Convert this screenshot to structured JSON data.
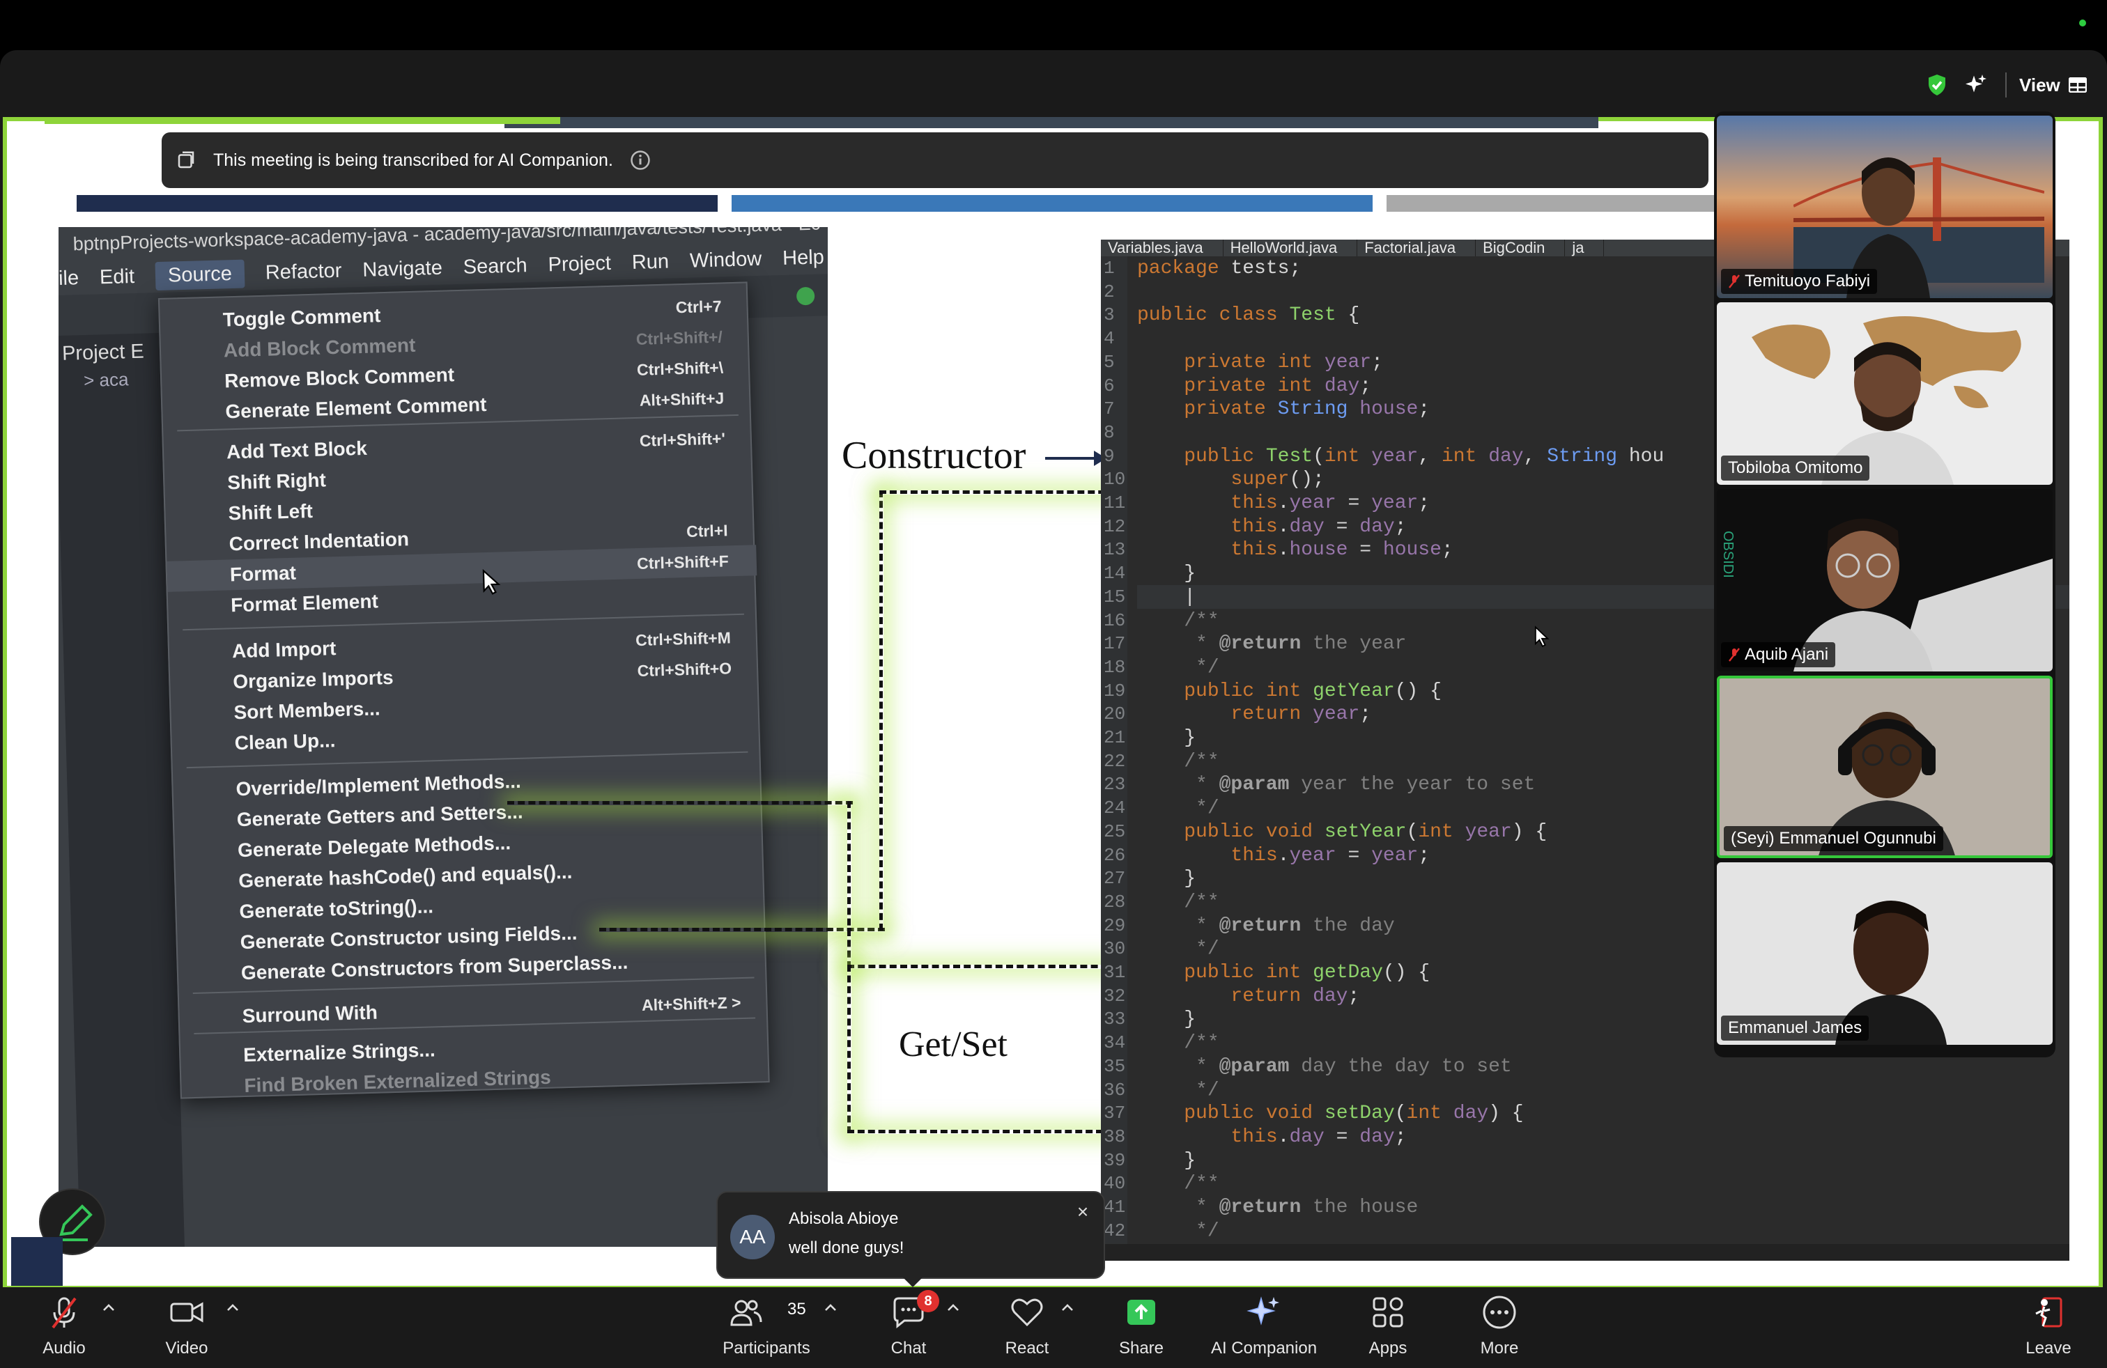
{
  "window": {
    "status_color": "#2ecc40"
  },
  "topbar": {
    "view_label": "View",
    "shield_icon": "shield-check-icon",
    "sparkle_icon": "ai-sparkle-icon"
  },
  "transcription_banner": {
    "text": "This meeting is being transcribed for AI Companion."
  },
  "slide": {
    "label_constructor": "Constructor",
    "label_getset": "Get/Set",
    "accent_colors": [
      "#1f2d4e",
      "#3a78b8",
      "#a9a9a9",
      "#8ed43a"
    ]
  },
  "eclipse": {
    "title": "bptnpProjects-workspace-academy-java - academy-java/src/main/java/tests/Test.java - Ec",
    "menubar": [
      "ile",
      "Edit",
      "Source",
      "Refactor",
      "Navigate",
      "Search",
      "Project",
      "Run",
      "Window",
      "Help"
    ],
    "active_menu": "Source",
    "project_panel_title": "Project E",
    "project_row": "> aca",
    "menu_items": [
      {
        "label": "Toggle Comment",
        "shortcut": "Ctrl+7"
      },
      {
        "label": "Add Block Comment",
        "shortcut": "Ctrl+Shift+/",
        "disabled": true
      },
      {
        "label": "Remove Block Comment",
        "shortcut": "Ctrl+Shift+\\"
      },
      {
        "label": "Generate Element Comment",
        "shortcut": "Alt+Shift+J"
      },
      {
        "label": "Add Text Block",
        "shortcut": "Ctrl+Shift+'"
      },
      {
        "label": "Shift Right",
        "shortcut": ""
      },
      {
        "label": "Shift Left",
        "shortcut": ""
      },
      {
        "label": "Correct Indentation",
        "shortcut": "Ctrl+I"
      },
      {
        "label": "Format",
        "shortcut": "Ctrl+Shift+F",
        "highlighted": true
      },
      {
        "label": "Format Element",
        "shortcut": ""
      },
      {
        "label": "Add Import",
        "shortcut": "Ctrl+Shift+M"
      },
      {
        "label": "Organize Imports",
        "shortcut": "Ctrl+Shift+O"
      },
      {
        "label": "Sort Members...",
        "shortcut": ""
      },
      {
        "label": "Clean Up...",
        "shortcut": ""
      },
      {
        "label": "Override/Implement Methods...",
        "shortcut": ""
      },
      {
        "label": "Generate Getters and Setters...",
        "shortcut": ""
      },
      {
        "label": "Generate Delegate Methods...",
        "shortcut": ""
      },
      {
        "label": "Generate hashCode() and equals()...",
        "shortcut": ""
      },
      {
        "label": "Generate toString()...",
        "shortcut": ""
      },
      {
        "label": "Generate Constructor using Fields...",
        "shortcut": ""
      },
      {
        "label": "Generate Constructors from Superclass...",
        "shortcut": ""
      },
      {
        "label": "Surround With",
        "shortcut": "Alt+Shift+Z >"
      },
      {
        "label": "Externalize Strings...",
        "shortcut": ""
      },
      {
        "label": "Find Broken Externalized Strings",
        "shortcut": "",
        "disabled": true
      }
    ]
  },
  "code_editor": {
    "tabs": [
      "Variables.java",
      "HelloWorld.java",
      "Factorial.java",
      "BigCodin",
      "ja"
    ],
    "line_numbers": [
      "1",
      "2",
      "3",
      "4",
      "5",
      "6",
      "7",
      "8",
      "9",
      "10",
      "11",
      "12",
      "13",
      "14",
      "15",
      "16",
      "17",
      "18",
      "19",
      "20",
      "21",
      "22",
      "23",
      "24",
      "25",
      "26",
      "27",
      "28",
      "29",
      "30",
      "31",
      "32",
      "33",
      "34",
      "35",
      "36",
      "37",
      "38",
      "39",
      "40",
      "41",
      "42"
    ],
    "lines": [
      "package tests;",
      "",
      "public class Test {",
      "",
      "    private int year;",
      "    private int day;",
      "    private String house;",
      "",
      "    public Test(int year, int day, String hou",
      "        super();",
      "        this.year = year;",
      "        this.day = day;",
      "        this.house = house;",
      "    }",
      "    |",
      "    /**",
      "     * @return the year",
      "     */",
      "    public int getYear() {",
      "        return year;",
      "    }",
      "    /**",
      "     * @param year the year to set",
      "     */",
      "    public void setYear(int year) {",
      "        this.year = year;",
      "    }",
      "    /**",
      "     * @return the day",
      "     */",
      "    public int getDay() {",
      "        return day;",
      "    }",
      "    /**",
      "     * @param day the day to set",
      "     */",
      "    public void setDay(int day) {",
      "        this.day = day;",
      "    }",
      "    /**",
      "     * @return the house",
      "     */"
    ]
  },
  "participants_panel": {
    "tiles": [
      {
        "name": "Temituoyo Fabiyi",
        "muted": true,
        "speaking": false
      },
      {
        "name": "Tobiloba Omitomo",
        "muted": false,
        "speaking": false
      },
      {
        "name": "Aquib Ajani",
        "muted": true,
        "speaking": false
      },
      {
        "name": "(Seyi)  Emmanuel Ogunnubi",
        "muted": false,
        "speaking": true
      },
      {
        "name": "Emmanuel James",
        "muted": false,
        "speaking": false
      }
    ],
    "speaking_color": "#35c73a"
  },
  "chat_popup": {
    "initials": "AA",
    "sender": "Abisola Abioye",
    "message": "well done guys!"
  },
  "toolbar": {
    "audio": "Audio",
    "video": "Video",
    "participants": "Participants",
    "participants_count": "35",
    "chat": "Chat",
    "chat_badge": "8",
    "react": "React",
    "share": "Share",
    "ai_companion": "AI Companion",
    "apps": "Apps",
    "more": "More",
    "leave": "Leave",
    "share_color": "#35c759",
    "leave_color": "#e0312f"
  }
}
